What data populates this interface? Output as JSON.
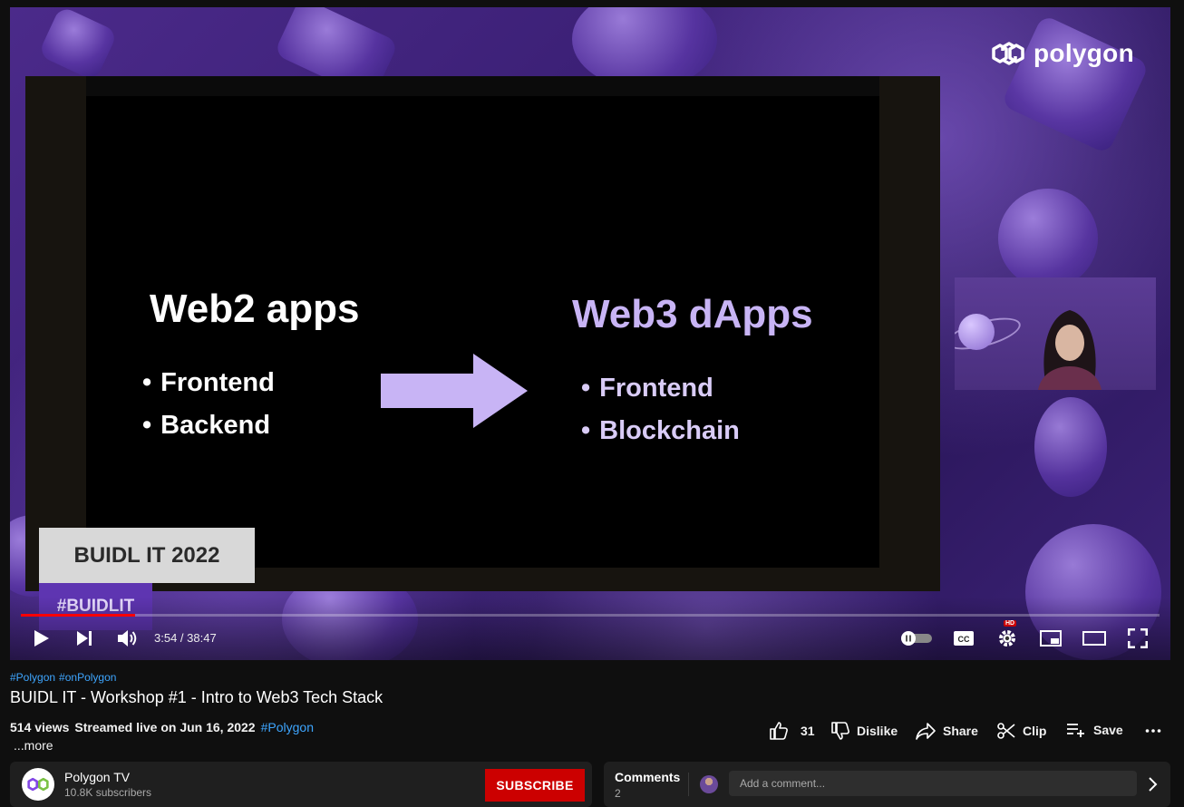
{
  "player": {
    "brand": "polygon",
    "slide": {
      "left_heading": "Web2 apps",
      "left_bullets": [
        "Frontend",
        "Backend"
      ],
      "right_heading": "Web3 dApps",
      "right_bullets": [
        "Frontend",
        "Blockchain"
      ]
    },
    "lower_third": {
      "line1": "BUIDL IT 2022",
      "line2": "#BUIDLIT"
    },
    "time": {
      "current": "3:54",
      "separator": " / ",
      "duration": "38:47"
    },
    "progress_fraction": 0.1006,
    "hd_badge": "HD",
    "colors": {
      "progress": "#ff0000",
      "accent_purple": "#5e35b1"
    }
  },
  "tags": [
    "#Polygon",
    "#onPolygon"
  ],
  "video_title": "BUIDL IT - Workshop #1 - Intro to Web3 Tech Stack",
  "description": {
    "views": "514 views",
    "streamed": "Streamed live on Jun 16, 2022",
    "hashtag": "#Polygon",
    "more": "...more"
  },
  "actions": {
    "likes": "31",
    "dislike": "Dislike",
    "share": "Share",
    "clip": "Clip",
    "save": "Save"
  },
  "channel": {
    "name": "Polygon TV",
    "subscribers": "10.8K subscribers",
    "subscribe_label": "SUBSCRIBE"
  },
  "comments": {
    "title": "Comments",
    "count": "2",
    "placeholder": "Add a comment..."
  }
}
